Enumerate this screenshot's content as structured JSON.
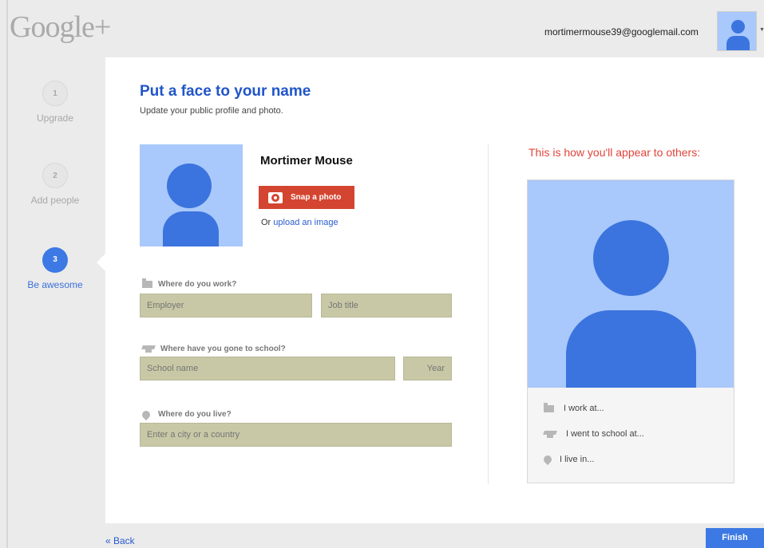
{
  "header": {
    "logo": "Google+",
    "email": "mortimermouse39@googlemail.com"
  },
  "steps": [
    {
      "number": "1",
      "label": "Upgrade",
      "state": "done"
    },
    {
      "number": "2",
      "label": "Add people",
      "state": "done"
    },
    {
      "number": "3",
      "label": "Be awesome",
      "state": "active"
    }
  ],
  "main": {
    "title": "Put a face to your name",
    "subtitle": "Update your public profile and photo.",
    "profile_name": "Mortimer Mouse",
    "snap_label": "Snap a photo",
    "upload_prefix": "Or",
    "upload_link": "upload an image",
    "work": {
      "label": "Where do you work?",
      "employer_placeholder": "Employer",
      "job_title_placeholder": "Job title"
    },
    "school": {
      "label": "Where have you gone to school?",
      "school_placeholder": "School name",
      "year_placeholder": "Year"
    },
    "live": {
      "label": "Where do you live?",
      "city_placeholder": "Enter a city or a country"
    }
  },
  "preview": {
    "title": "This is how you'll appear to others:",
    "work_line": "I work at...",
    "school_line": "I went to school at...",
    "live_line": "I live in..."
  },
  "footer": {
    "back_label": "« Back",
    "finish_label": "Finish"
  },
  "colors": {
    "accent_blue": "#3c79e4",
    "snap_red": "#d44531",
    "preview_title_red": "#e0443a",
    "avatar_light": "#a9c8fb",
    "avatar_dark": "#3b74de",
    "input_fill": "#c8c8a6"
  },
  "icons": [
    "camera-icon",
    "building-icon",
    "graduation-cap-icon",
    "map-pin-icon",
    "account-caret-icon"
  ]
}
